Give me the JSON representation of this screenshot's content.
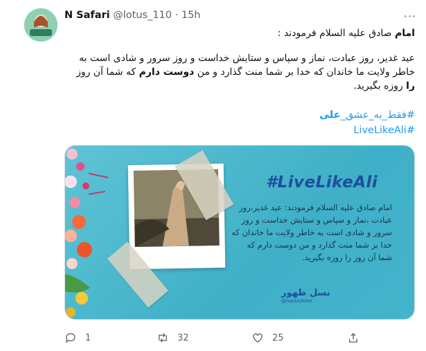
{
  "tweet": {
    "author_name": "N Safari",
    "handle": "@lotus_110",
    "separator": "·",
    "time": "15h",
    "more_icon": "more-icon",
    "line1_bold": "امام",
    "line1_rest": " صادق علیه السلام فرمودند :",
    "para_part1": "عید غدیر، روز عبادت، نماز و سپاس و ستایش خداست و روز سرور و شادی است به خاطر ولایت ما خاندان که خدا بر شما منت گذارد و من ",
    "para_bold1": "دوست دارم",
    "para_part2": " که شما آن روز ",
    "para_bold2": "را",
    "para_part3": " روزه بگیرید.",
    "hashtag1_part1": "#فقط_به_عشق_",
    "hashtag1_bold": "علی",
    "hashtag2": "#LiveLikeAli"
  },
  "media": {
    "title": "#LiveLikeAli",
    "text": "امام صادق علیه السلام فرمودند: عید غدیر،روز عبادت ،نماز و سپاس و ستایش خداست و روز سرور و شادی است به خاطر ولایت ما خاندان که خدا بر شما منت گذارد و من دوست دارم که شما آن روز را روزه بگیرید.",
    "logo_text": "نسل ظهور",
    "logo_sub": "@naslzohoor"
  },
  "actions": {
    "reply_count": "1",
    "retweet_count": "32",
    "like_count": "25"
  },
  "colors": {
    "link": "#1d9bf0",
    "muted": "#536471",
    "media_bg": "#4fbad0"
  }
}
